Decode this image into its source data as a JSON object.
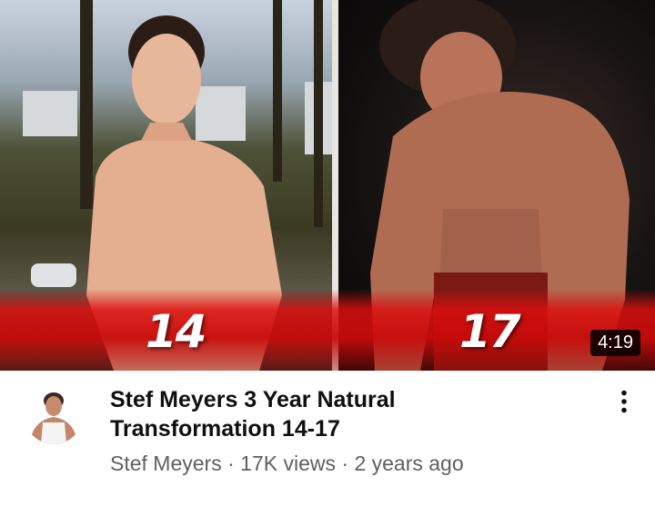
{
  "video": {
    "thumbnail": {
      "left_label": "14",
      "right_label": "17",
      "duration": "4:19",
      "accent_color": "#e01010"
    },
    "title_line1": "Stef Meyers 3 Year Natural",
    "title_line2": "Transformation 14-17",
    "channel": "Stef Meyers",
    "separator": " · ",
    "views": "17K views",
    "age": "2 years ago",
    "more_icon": "more-vert-icon",
    "avatar_icon": "channel-avatar"
  }
}
